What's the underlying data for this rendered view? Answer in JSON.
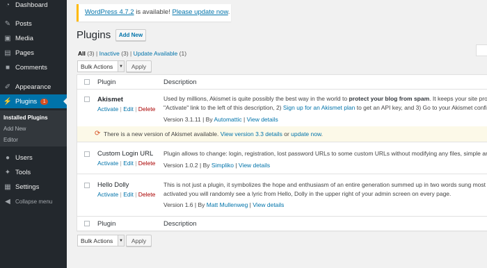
{
  "sidebar": {
    "items": [
      {
        "label": "Dashboard",
        "icon": "dashboard-icon"
      },
      {
        "label": "Posts",
        "icon": "pin-icon"
      },
      {
        "label": "Media",
        "icon": "media-icon"
      },
      {
        "label": "Pages",
        "icon": "pages-icon"
      },
      {
        "label": "Comments",
        "icon": "comment-icon"
      },
      {
        "label": "Appearance",
        "icon": "brush-icon"
      },
      {
        "label": "Plugins",
        "icon": "plug-icon",
        "badge": "1"
      },
      {
        "label": "Users",
        "icon": "users-icon"
      },
      {
        "label": "Tools",
        "icon": "wrench-icon"
      },
      {
        "label": "Settings",
        "icon": "settings-icon"
      },
      {
        "label": "Collapse menu",
        "icon": "collapse-icon"
      }
    ],
    "submenu": [
      "Installed Plugins",
      "Add New",
      "Editor"
    ]
  },
  "notice": {
    "link1": "WordPress 4.7.2",
    "text": " is available! ",
    "link2": "Please update now",
    "end": "."
  },
  "header": {
    "title": "Plugins",
    "add_new": "Add New"
  },
  "filters": {
    "all": "All",
    "all_count": "(3)",
    "inactive": "Inactive",
    "inactive_count": "(3)",
    "update": "Update Available",
    "update_count": "(1)",
    "sep": "|"
  },
  "bulk": {
    "select": "Bulk Actions",
    "apply": "Apply"
  },
  "table": {
    "col_plugin": "Plugin",
    "col_description": "Description",
    "plugins": [
      {
        "name": "Akismet",
        "activate": "Activate",
        "edit": "Edit",
        "delete": "Delete",
        "desc_line1_a": "Used by millions, Akismet is quite possibly the best way in the world to ",
        "desc_line1_b": "protect your blog from spam",
        "desc_line1_c": ". It keeps your site protect",
        "desc_line2_a": "\"Activate\" link to the left of this description, 2) ",
        "desc_line2_b": "Sign up for an Akismet plan",
        "desc_line2_c": " to get an API key, and 3) Go to your Akismet configur",
        "version": "Version 3.1.11",
        "by": "By",
        "author": "Automattic",
        "details": "View details",
        "update_text": "There is a new version of Akismet available. ",
        "update_link": "View version 3.3 details",
        "update_or": " or ",
        "update_now": "update now",
        "update_end": "."
      },
      {
        "name": "Custom Login URL",
        "activate": "Activate",
        "edit": "Edit",
        "delete": "Delete",
        "desc_line1": "Plugin allows to change: login, registration, lost password URLs to some custom URLs without modifying any files, simple and sw",
        "version": "Version 1.0.2",
        "by": "By",
        "author": "Simpliko",
        "details": "View details"
      },
      {
        "name": "Hello Dolly",
        "activate": "Activate",
        "edit": "Edit",
        "delete": "Delete",
        "desc_line1": "This is not just a plugin, it symbolizes the hope and enthusiasm of an entire generation summed up in two words sung most fan",
        "desc_line2": "activated you will randomly see a lyric from Hello, Dolly in the upper right of your admin screen on every page.",
        "version": "Version 1.6",
        "by": "By",
        "author": "Matt Mullenweg",
        "details": "View details"
      }
    ]
  },
  "colors": {
    "sidebar": "#23282d",
    "accent": "#0073aa",
    "delete": "#a00",
    "notice_border": "#ffb900"
  }
}
